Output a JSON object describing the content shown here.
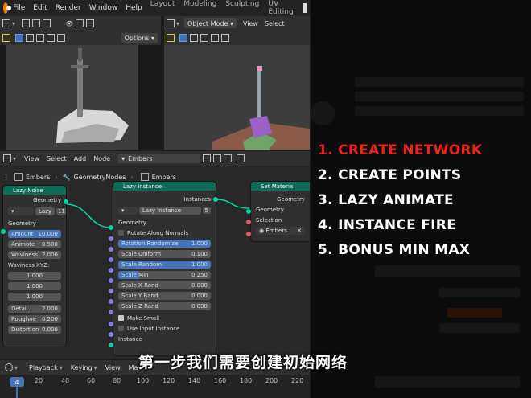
{
  "menu": {
    "items": [
      "File",
      "Edit",
      "Render",
      "Window",
      "Help"
    ],
    "workspaces": [
      "Layout",
      "Modeling",
      "Sculpting",
      "UV Editing"
    ]
  },
  "viewport_right": {
    "mode": "Object Mode",
    "menus": [
      "View",
      "Select"
    ]
  },
  "viewport_left": {
    "options": "Options"
  },
  "node_editor": {
    "header_menus": [
      "View",
      "Select",
      "Add",
      "Node"
    ],
    "tree_name": "Embers",
    "breadcrumb": [
      "Embers",
      "GeometryNodes",
      "Embers"
    ]
  },
  "nodes": {
    "lazy_noise": {
      "title": "Lazy Noise",
      "output": "Geometry",
      "group_name": "Lazy",
      "users": "11",
      "input_geometry": "Geometry",
      "amount_label": "Amount",
      "amount_value": "10.000",
      "animate_label": "Animate",
      "animate_value": "0.500",
      "waviness_label": "Waviness",
      "waviness_value": "2.000",
      "waviness_xyz_label": "Waviness XYZ:",
      "xyz": [
        "1.000",
        "1.000",
        "1.000"
      ],
      "detail_label": "Detail",
      "detail_value": "2.000",
      "roughness_label": "Roughne",
      "roughness_value": "0.200",
      "distortion_label": "Distortion",
      "distortion_value": "0.000"
    },
    "lazy_instance": {
      "title": "Lazy Instance",
      "output": "Instances",
      "group_name": "Lazy Instance",
      "users": "5",
      "input_geometry": "Geometry",
      "rotate_normals": "Rotate Along Normals",
      "rotation_randomize_label": "Rotation Randomize",
      "rotation_randomize_value": "1.000",
      "scale_uniform_label": "Scale Uniform",
      "scale_uniform_value": "0.100",
      "scale_random_label": "Scale Random",
      "scale_random_value": "1.000",
      "scale_min_label": "Scale Min",
      "scale_min_value": "0.250",
      "scale_x_label": "Scale X Rand",
      "scale_x_value": "0.000",
      "scale_y_label": "Scale Y Rand",
      "scale_y_value": "0.000",
      "scale_z_label": "Scale Z Rand",
      "scale_z_value": "0.000",
      "make_small": "Make Small",
      "use_input_instance": "Use Input Instance",
      "instance_label": "Instance"
    },
    "set_material": {
      "title": "Set Material",
      "output": "Geometry",
      "input_geometry": "Geometry",
      "selection": "Selection",
      "material": "Embers"
    }
  },
  "timeline": {
    "menus": [
      "Playback",
      "Keying",
      "View",
      "Ma"
    ],
    "current_frame": "4",
    "ticks": [
      "20",
      "40",
      "60",
      "80",
      "100",
      "120",
      "140",
      "160",
      "180",
      "200",
      "220"
    ]
  },
  "steps": [
    {
      "text": "1. CREATE NETWORK",
      "color": "#e8241c"
    },
    {
      "text": "2. CREATE POINTS",
      "color": "#ffffff"
    },
    {
      "text": "3. LAZY ANIMATE",
      "color": "#ffffff"
    },
    {
      "text": "4. INSTANCE FIRE",
      "color": "#ffffff"
    },
    {
      "text": "5. BONUS MIN MAX",
      "color": "#ffffff"
    }
  ],
  "subtitle": "第一步我们需要创建初始网络"
}
